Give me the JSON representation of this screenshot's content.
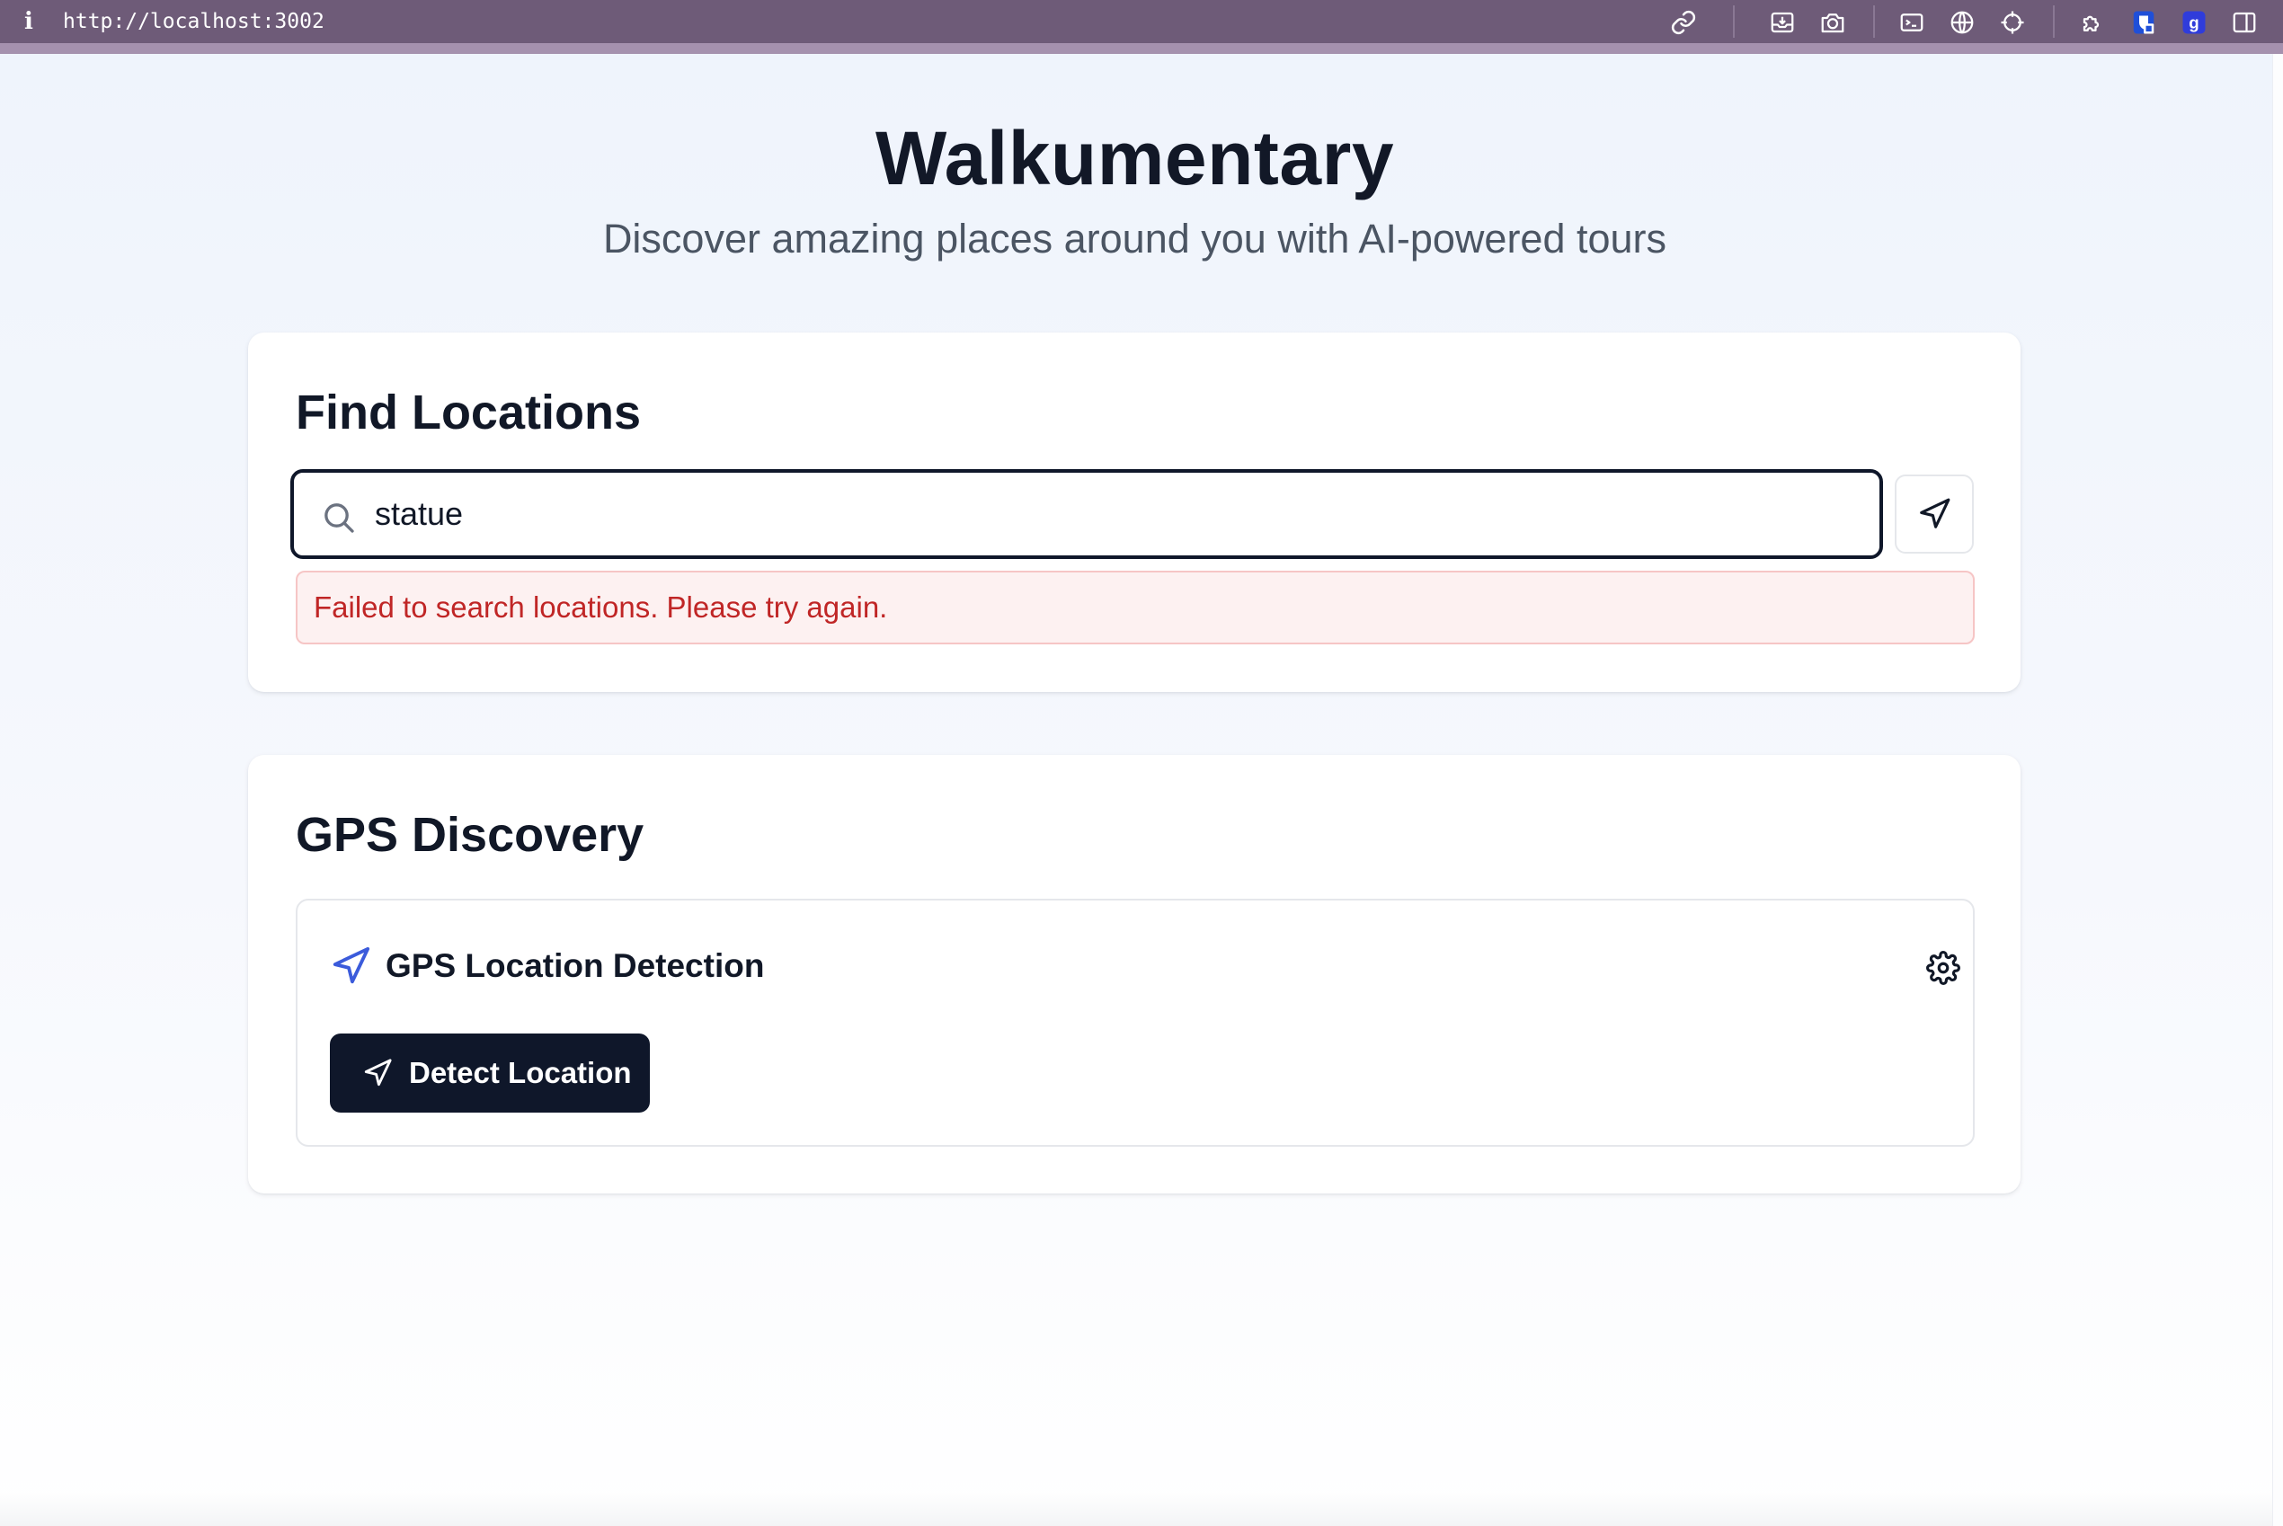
{
  "browser": {
    "url": "http://localhost:3002",
    "toolbar_icons": [
      "link-icon",
      "inbox-download-icon",
      "camera-icon",
      "terminal-icon",
      "globe-icon",
      "crosshair-icon",
      "extension-puzzle-icon",
      "bitwarden-shield-icon",
      "g-extension-icon",
      "sidebar-toggle-icon"
    ],
    "accent_colors": {
      "chrome_bar": "#6e5b78",
      "chrome_strip": "#a591ae"
    }
  },
  "hero": {
    "title": "Walkumentary",
    "subtitle": "Discover amazing places around you with AI-powered tours"
  },
  "find_locations": {
    "title": "Find Locations",
    "search_value": "statue",
    "error_message": "Failed to search locations. Please try again.",
    "error_color": "#c02626"
  },
  "gps_discovery": {
    "title": "GPS Discovery",
    "panel_title": "GPS Location Detection",
    "detect_button_label": "Detect Location",
    "icon_accent": "#3b5bdb"
  }
}
